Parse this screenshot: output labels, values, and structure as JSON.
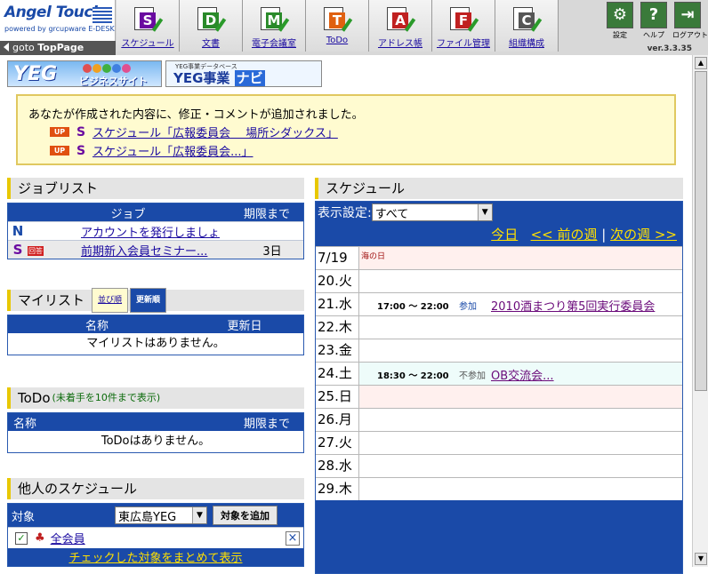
{
  "app": {
    "brand": "Angel Touch",
    "powered": "powered by grcupware E-DESK",
    "goto_prefix": "goto",
    "goto_page": "TopPage",
    "version": "ver.3.3.35"
  },
  "nav": [
    {
      "label": "スケジュール",
      "letter": "S",
      "color": "#6a0aa0"
    },
    {
      "label": "文書",
      "letter": "D",
      "color": "#2a8a2a"
    },
    {
      "label": "電子会議室",
      "letter": "M",
      "color": "#2a8a2a"
    },
    {
      "label": "ToDo",
      "letter": "T",
      "color": "#e06010"
    },
    {
      "label": "アドレス帳",
      "letter": "A",
      "color": "#c02020"
    },
    {
      "label": "ファイル管理",
      "letter": "F",
      "color": "#c02020"
    },
    {
      "label": "組織構成",
      "letter": "C",
      "color": "#555555"
    }
  ],
  "tools": [
    {
      "label": "設定",
      "glyph": "⚙"
    },
    {
      "label": "ヘルプ",
      "glyph": "?"
    },
    {
      "label": "ログアウト",
      "glyph": "⇥"
    }
  ],
  "banners": {
    "yeg": {
      "main": "YEG",
      "sub": "ビジネスサイト"
    },
    "navi": {
      "small": "YEG事業データベース",
      "main": "YEG事業",
      "navi": "ナビ"
    }
  },
  "notice": {
    "message": "あなたが作成された内容に、修正・コメントが追加されました。",
    "up_badge": "UP",
    "items": [
      "スケジュール「広報委員会　 場所シダックス」",
      "スケジュール「広報委員会...」"
    ]
  },
  "joblist": {
    "title": "ジョブリスト",
    "col_job": "ジョブ",
    "col_due": "期限まで",
    "rows": [
      {
        "badge": "N",
        "tag": "",
        "title": "アカウントを発行しましょ",
        "due": ""
      },
      {
        "badge": "S",
        "tag": "回答",
        "title": "前期新入会員セミナー...",
        "due": "3日"
      }
    ]
  },
  "mylist": {
    "title": "マイリスト",
    "tab_order": "並び順",
    "tab_updated": "更新順",
    "col_name": "名称",
    "col_updated": "更新日",
    "empty": "マイリストはありません。"
  },
  "todo": {
    "title": "ToDo",
    "subtitle": "(未着手を10件まで表示)",
    "col_name": "名称",
    "col_due": "期限まで",
    "empty": "ToDoはありません。"
  },
  "others": {
    "title": "他人のスケジュール",
    "target_label": "対象",
    "target_select": "東広島YEG",
    "add_button": "対象を追加",
    "member": "全会員",
    "footer": "チェックした対象をまとめて表示"
  },
  "schedule": {
    "title": "スケジュール",
    "setting_label": "表示設定:",
    "setting_value": "すべて",
    "nav_today": "今日",
    "nav_prev": "<< 前の週",
    "nav_sep": "|",
    "nav_next": "次の週 >>",
    "days": [
      {
        "label": "7/19 月",
        "holiday": "海の日",
        "kind": "hol",
        "event": null
      },
      {
        "label": "20.火",
        "holiday": "",
        "kind": "",
        "event": null
      },
      {
        "label": "21.水",
        "holiday": "",
        "kind": "",
        "event": {
          "time": "17:00 ～ 22:00",
          "status": "参加",
          "status_kind": "in",
          "title": "2010酒まつり第5回実行委員会"
        }
      },
      {
        "label": "22.木",
        "holiday": "",
        "kind": "",
        "event": null
      },
      {
        "label": "23.金",
        "holiday": "",
        "kind": "",
        "event": null
      },
      {
        "label": "24.土",
        "holiday": "",
        "kind": "today",
        "event": {
          "time": "18:30 ～ 22:00",
          "status": "不参加",
          "status_kind": "out",
          "title": "OB交流会..."
        }
      },
      {
        "label": "25.日",
        "holiday": "",
        "kind": "hol",
        "event": null
      },
      {
        "label": "26.月",
        "holiday": "",
        "kind": "",
        "event": null
      },
      {
        "label": "27.火",
        "holiday": "",
        "kind": "",
        "event": null
      },
      {
        "label": "28.水",
        "holiday": "",
        "kind": "",
        "event": null
      },
      {
        "label": "29.木",
        "holiday": "",
        "kind": "",
        "event": null
      }
    ]
  }
}
